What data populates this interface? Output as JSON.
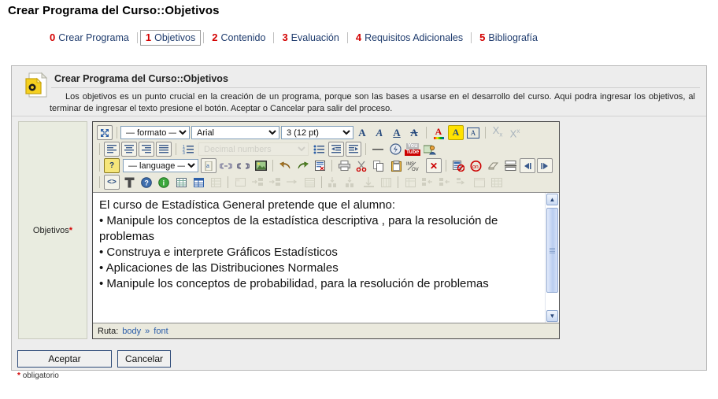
{
  "header": {
    "title": "Crear Programa del Curso::Objetivos",
    "tabs": [
      {
        "num": "0",
        "label": "Crear Programa",
        "active": false
      },
      {
        "num": "1",
        "label": "Objetivos",
        "active": true
      },
      {
        "num": "2",
        "label": "Contenido",
        "active": false
      },
      {
        "num": "3",
        "label": "Evaluación",
        "active": false
      },
      {
        "num": "4",
        "label": "Requisitos Adicionales",
        "active": false
      },
      {
        "num": "5",
        "label": "Bibliografía",
        "active": false
      }
    ]
  },
  "note": {
    "title": "Crear Programa del Curso::Objetivos",
    "text": "Los objetivos es un punto crucial en la creación de un programa, porque son las bases a usarse en el desarrollo del curso. Aqui podra ingresar los objetivos, al terminar de ingresar el texto presione el botón. Aceptar o Cancelar para salir del proceso.",
    "icon": "note-page-icon"
  },
  "form": {
    "field_label": "Objetivos",
    "required_mark": "*"
  },
  "editor": {
    "toolbar_row1": {
      "fullscreen_icon": "fullscreen-icon",
      "format_select": "— formato —",
      "font_select": "Arial",
      "size_select": "3 (12 pt)",
      "bold": "A",
      "italic": "A",
      "underline": "A",
      "strikethrough": "A",
      "forecolor": "A",
      "backcolor": "A",
      "removeformat": "A",
      "subscript": "X",
      "superscript": "X"
    },
    "toolbar_row2": {
      "align_left": "align-left-icon",
      "align_center": "align-center-icon",
      "align_right": "align-right-icon",
      "align_justify": "align-justify-icon",
      "ordered_list": "ordered-list-icon",
      "list_style_select": "Decimal numbers",
      "unordered_list": "unordered-list-icon",
      "outdent": "outdent-icon",
      "indent": "indent-icon",
      "horizontal_rule": "horizontal-rule-icon",
      "flash": "flash-icon",
      "youtube": "youtube-icon",
      "media": "media-icon"
    },
    "toolbar_row3": {
      "help": "?",
      "language_select": "— language —",
      "anchor": "anchor-icon",
      "link": "link-icon",
      "unlink": "unlink-icon",
      "image": "image-icon",
      "undo": "undo-icon",
      "redo": "redo-icon",
      "select_all": "select-all-icon",
      "print": "print-icon",
      "cut": "cut-icon",
      "copy": "copy-icon",
      "paste": "paste-icon",
      "insert_overwrite": "INS/OV",
      "delete": "delete-icon",
      "paste_word": "paste-word-icon",
      "no_entry": "no-entry-icon",
      "eraser": "eraser-icon",
      "page_break": "page-break-icon",
      "ltr": "direction-ltr-icon",
      "rtl": "direction-rtl-icon"
    },
    "toolbar_row4": {
      "source_code": "<>",
      "cleanup": "cleanup-icon",
      "help_circle": "?",
      "info_circle": "i",
      "table_grid": "table-grid-icon",
      "table_insert": "table-insert-icon",
      "table_props": "table-properties-icon",
      "table_cell_props": "table-cell-properties-icon",
      "row_before": "row-insert-before-icon",
      "row_after": "row-insert-after-icon",
      "row_delete": "row-delete-icon",
      "table_split": "table-split-icon",
      "col_before": "column-insert-before-icon",
      "col_after": "column-insert-after-icon",
      "col_delete": "column-delete-icon",
      "cell_merge": "cell-merge-icon",
      "cell_split": "cell-split-icon",
      "row_props": "row-properties-icon",
      "table_row_tools": "table-row-tools-icon"
    },
    "document_lines": [
      "El curso de Estadística General pretende que el alumno:",
      "• Manipule los conceptos de la estadística descriptiva , para la resolución de problemas",
      "• Construya e interprete  Gráficos Estadísticos",
      "• Aplicaciones de las Distribuciones Normales",
      "• Manipule los conceptos de probabilidad, para la resolución de problemas"
    ],
    "statusbar": {
      "label": "Ruta:",
      "path_root": "body",
      "path_sep": "»",
      "path_node": "font"
    }
  },
  "footer": {
    "accept_label": "Aceptar",
    "cancel_label": "Cancelar",
    "required_note_mark": "*",
    "required_note_text": "obligatorio"
  },
  "colors": {
    "tab_number": "#d30000",
    "tab_label": "#1f3c6e",
    "required": "#d30000",
    "panel_bg": "#ededed",
    "label_cell_bg": "#e9ece0",
    "toolbar_bg": "#eae9dd"
  }
}
